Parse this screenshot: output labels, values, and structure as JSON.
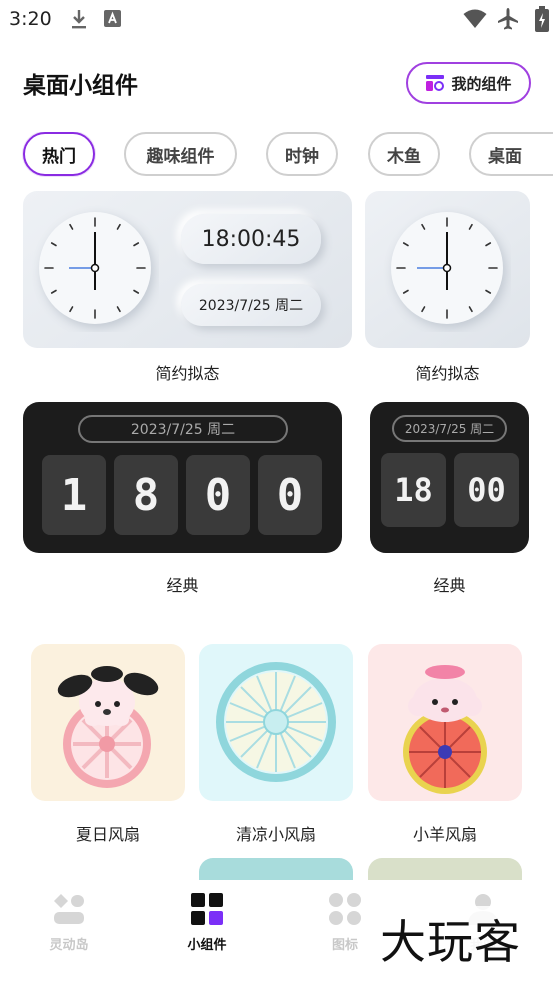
{
  "status_bar": {
    "time": "3:20"
  },
  "header": {
    "title": "桌面小组件",
    "my_widgets_label": "我的组件"
  },
  "tabs": [
    {
      "label": "热门",
      "active": true
    },
    {
      "label": "趣味组件",
      "active": false
    },
    {
      "label": "时钟",
      "active": false
    },
    {
      "label": "木鱼",
      "active": false
    },
    {
      "label": "桌面"
    }
  ],
  "widgets": {
    "neu_large": {
      "time": "18:00:45",
      "date": "2023/7/25 周二",
      "caption": "简约拟态"
    },
    "neu_small": {
      "caption": "简约拟态"
    },
    "classic_large": {
      "date": "2023/7/25 周二",
      "digits": [
        "1",
        "8",
        "0",
        "0"
      ],
      "caption": "经典"
    },
    "classic_small": {
      "date": "2023/7/25 周二",
      "digits": [
        "18",
        "00"
      ],
      "caption": "经典"
    }
  },
  "fans": [
    {
      "caption": "夏日风扇",
      "bg": "#fbf1de"
    },
    {
      "caption": "清凉小风扇",
      "bg": "#e0f7fa"
    },
    {
      "caption": "小羊风扇",
      "bg": "#fde8e8"
    }
  ],
  "nav": [
    {
      "label": "灵动岛",
      "active": false
    },
    {
      "label": "小组件",
      "active": true
    },
    {
      "label": "图标",
      "active": false
    },
    {
      "label": "我的",
      "active": false
    }
  ],
  "watermark": "大玩客",
  "colors": {
    "accent": "#8a2be2",
    "tab_border": "#cfcfcf",
    "dark_card": "#1c1c1c"
  }
}
